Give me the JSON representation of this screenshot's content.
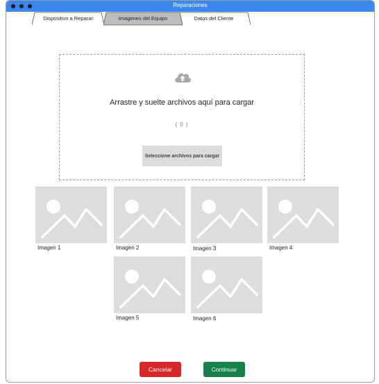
{
  "window": {
    "title": "Reparaciones"
  },
  "tabs": [
    {
      "label": "Dispositivo a Reparar",
      "active": false
    },
    {
      "label": "Imagenes del Equipo",
      "active": true
    },
    {
      "label": "Datos del Cliente",
      "active": false
    }
  ],
  "dropzone": {
    "icon": "cloud-upload-icon",
    "instructions": "Arrastre y suelte archivos aquí para cargar",
    "counter": "( 0 )",
    "select_button": "Seleccione archivos para cargar"
  },
  "images": [
    {
      "label": "Imagen 1",
      "icon": "image-placeholder-icon"
    },
    {
      "label": "Imagen 2",
      "icon": "image-placeholder-icon"
    },
    {
      "label": "Imagen 3",
      "icon": "image-placeholder-icon"
    },
    {
      "label": "Imagen 4",
      "icon": "image-placeholder-icon"
    },
    {
      "label": "Imagen 5",
      "icon": "image-placeholder-icon"
    },
    {
      "label": "Imagen 6",
      "icon": "image-placeholder-icon"
    }
  ],
  "actions": {
    "cancel": "Cancelar",
    "continue": "Continuar"
  },
  "colors": {
    "titlebar": "#3b87f0",
    "cancel": "#d62a2a",
    "continue": "#18804a",
    "placeholder": "#dddddd"
  }
}
